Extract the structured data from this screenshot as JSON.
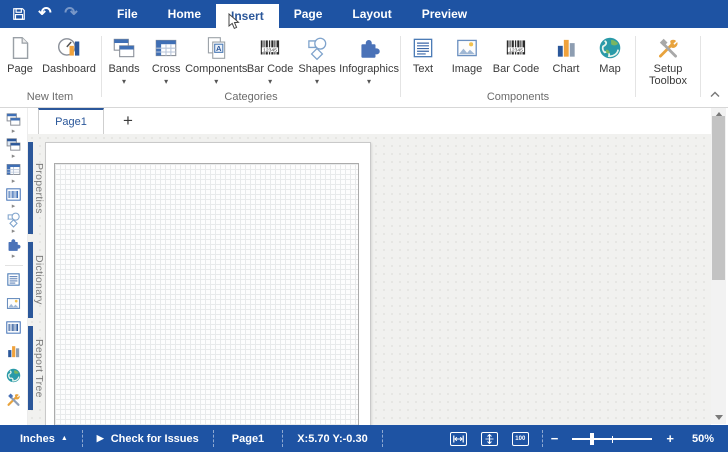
{
  "titlebar": {
    "menus": [
      "File",
      "Home",
      "Insert",
      "Page",
      "Layout",
      "Preview"
    ],
    "active_menu": "Insert"
  },
  "ribbon": {
    "groups": [
      {
        "label": "New Item",
        "buttons": [
          "Page",
          "Dashboard"
        ]
      },
      {
        "label": "Categories",
        "buttons": [
          "Bands",
          "Cross",
          "Components",
          "Bar Code",
          "Shapes",
          "Infographics"
        ]
      },
      {
        "label": "Components",
        "buttons": [
          "Text",
          "Image",
          "Bar Code",
          "Chart",
          "Map"
        ]
      },
      {
        "label": "",
        "buttons": [
          "Setup Toolbox"
        ]
      }
    ]
  },
  "pages": {
    "active_tab": "Page1",
    "add_label": "+"
  },
  "sidebar": {
    "panels": [
      "Properties",
      "Dictionary",
      "Report Tree"
    ]
  },
  "statusbar": {
    "units": "Inches",
    "check_issues": "Check for Issues",
    "page": "Page1",
    "coordinates": "X:5.70 Y:-0.30",
    "zoom_out": "−",
    "zoom_in": "+",
    "zoom_100": "100",
    "zoom_level": "50%"
  },
  "icons": [
    "save-icon",
    "undo-icon",
    "redo-icon",
    "page-icon",
    "dashboard-icon",
    "bands-icon",
    "cross-icon",
    "components-icon",
    "barcode-icon",
    "shapes-icon",
    "infographics-icon",
    "text-icon",
    "image-icon",
    "chart-icon",
    "map-icon",
    "setup-toolbox-icon",
    "collapse-ribbon-icon",
    "dropdown-arrow-icon",
    "fit-page-width-icon",
    "fit-whole-page-icon",
    "zoom-slider",
    "mouse-cursor"
  ],
  "colors": {
    "bar_blue": "#1E53A3",
    "accent_blue": "#2B579A",
    "icon_blue": "#3F6FB5",
    "chart_orange": "#F0A23C",
    "map_teal": "#2A9AA8"
  }
}
